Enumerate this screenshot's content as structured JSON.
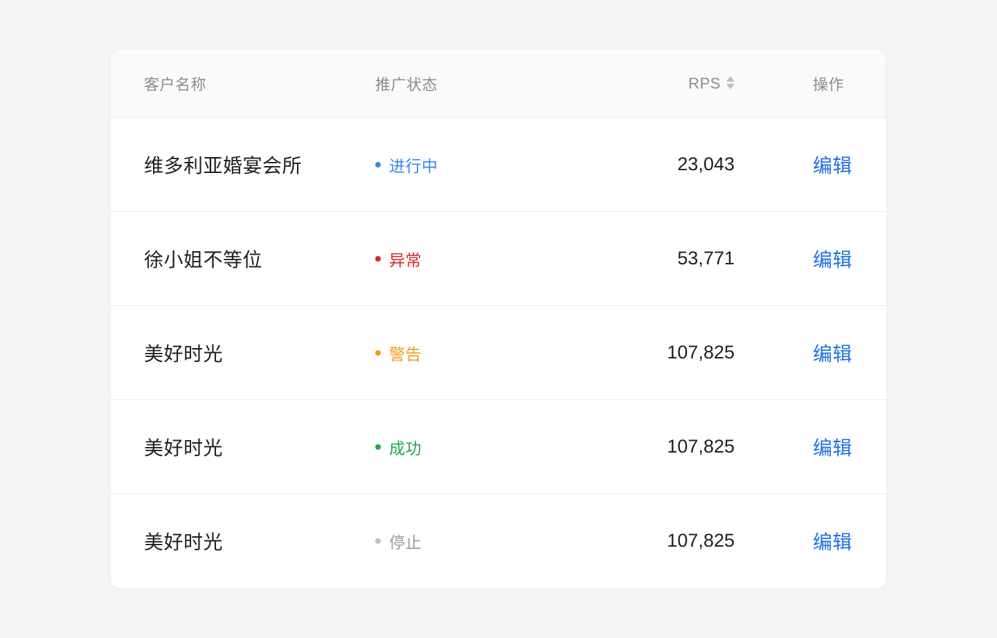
{
  "table": {
    "headers": {
      "name": "客户名称",
      "status": "推广状态",
      "rps": "RPS",
      "action": "操作"
    },
    "rows": [
      {
        "name": "维多利亚婚宴会所",
        "status": "进行中",
        "status_color": "#3a86e8",
        "rps": "23,043",
        "action": "编辑"
      },
      {
        "name": "徐小姐不等位",
        "status": "异常",
        "status_color": "#e02424",
        "rps": "53,771",
        "action": "编辑"
      },
      {
        "name": "美好时光",
        "status": "警告",
        "status_color": "#f09a1a",
        "rps": "107,825",
        "action": "编辑"
      },
      {
        "name": "美好时光",
        "status": "成功",
        "status_color": "#22a84a",
        "rps": "107,825",
        "action": "编辑"
      },
      {
        "name": "美好时光",
        "status": "停止",
        "status_color": "#bfbfbf",
        "status_text_color": "#999999",
        "rps": "107,825",
        "action": "编辑"
      }
    ]
  },
  "icons": {
    "sort": "sort-icon"
  },
  "colors": {
    "link": "#1f6fe5",
    "header_text": "#8c8c8c",
    "body_text": "#1f1f1f",
    "page_bg": "#f5f5f5",
    "card_bg": "#ffffff"
  }
}
